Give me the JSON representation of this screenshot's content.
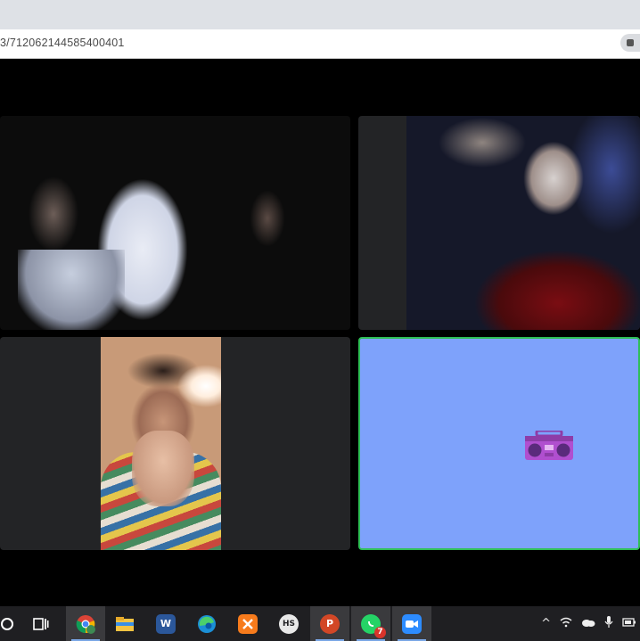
{
  "browser": {
    "url": "3/7120621445854004​01"
  },
  "participants": [
    {
      "id": 1,
      "label": "participant-ghost-costume"
    },
    {
      "id": 2,
      "label": "participant-skull-makeup"
    },
    {
      "id": 3,
      "label": "participant-striped-shirt"
    },
    {
      "id": 4,
      "label": "participant-no-video-boombox",
      "active_speaker": true,
      "tile_color": "#7ea2fb",
      "border_color": "#2fbf57"
    }
  ],
  "taskbar": {
    "apps": [
      {
        "name": "task-view-icon",
        "text": ""
      },
      {
        "name": "chrome-icon",
        "text": ""
      },
      {
        "name": "file-explorer-icon",
        "text": ""
      },
      {
        "name": "word-icon",
        "text": "W"
      },
      {
        "name": "edge-icon",
        "text": ""
      },
      {
        "name": "xampp-icon",
        "text": ""
      },
      {
        "name": "hs-app-icon",
        "text": "HS"
      },
      {
        "name": "powerpoint-icon",
        "text": "P"
      },
      {
        "name": "whatsapp-icon",
        "text": "",
        "badge": "7"
      },
      {
        "name": "zoom-icon",
        "text": ""
      }
    ]
  },
  "colors": {
    "taskbar_bg": "#1f1f22",
    "active_speaker": "#2fbf57",
    "boombox": "#8e3ca8"
  }
}
